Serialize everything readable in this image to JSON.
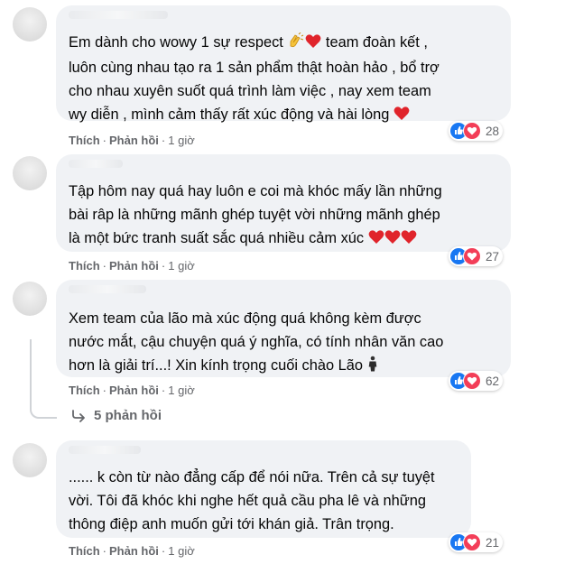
{
  "comments": [
    {
      "text": "Em dành cho wowy 1 sự respect ",
      "text_b": " team đoàn kết ,\nluôn cùng nhau tạo ra 1 sản phẩm thật hoàn hảo , bổ trợ\ncho nhau xuyên suốt quá trình làm việc , nay xem team\nwy diễn , mình cảm thấy rất xúc động và hài lòng ",
      "like_label": "Thích",
      "reply_label": "Phản hồi",
      "time": "1 giờ",
      "reaction_count": "28"
    },
    {
      "text": "Tập hôm nay quá hay luôn e coi mà khóc mấy lần những\nbài râp là những mãnh ghép tuyệt vời những mãnh ghép\nlà một bức tranh suất sắc quá nhiều cảm xúc ",
      "like_label": "Thích",
      "reply_label": "Phản hồi",
      "time": "1 giờ",
      "reaction_count": "27"
    },
    {
      "text": "Xem team của lão mà xúc động quá không kèm được\nnước mắt, cậu chuyện quá ý nghĩa, có tính nhân văn cao\nhơn là giải trí...! Xin kính trọng cuối chào Lão ",
      "like_label": "Thích",
      "reply_label": "Phản hồi",
      "time": "1 giờ",
      "reaction_count": "62"
    },
    {
      "text": "...... k còn từ nào đẳng cấp để nói nữa. Trên cả sự tuyệt\nvời. Tôi đã khóc khi nghe hết quả cầu pha lê và những\nthông điệp anh muốn gửi tới khán giả. Trân trọng.",
      "like_label": "Thích",
      "reply_label": "Phản hồi",
      "time": "1 giờ",
      "reaction_count": "21"
    }
  ],
  "view_replies": "5 phản hồi",
  "icons": [
    "clapping-hands-icon",
    "red-heart-icon",
    "person-in-suit-icon",
    "like-reaction-icon",
    "love-reaction-icon",
    "reply-arrow-icon"
  ],
  "colors": {
    "bubble": "#f0f2f5",
    "like": "#1877f2",
    "love": "#f33e58",
    "meta": "#65676b"
  }
}
